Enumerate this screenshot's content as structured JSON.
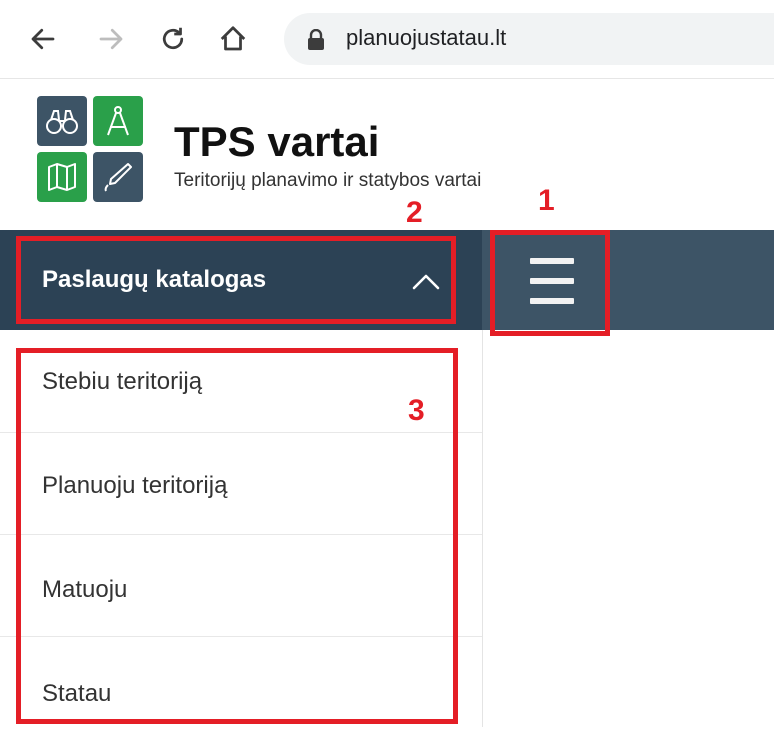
{
  "browser": {
    "url": "planuojustatau.lt",
    "icons": [
      "back-arrow-icon",
      "forward-arrow-icon",
      "reload-icon",
      "home-icon",
      "lock-icon"
    ]
  },
  "site": {
    "title": "TPS vartai",
    "subtitle": "Teritorijų planavimo ir statybos vartai",
    "logo_icons": [
      "binoculars-icon",
      "compass-icon",
      "map-icon",
      "pen-icon"
    ]
  },
  "nav": {
    "catalog_label": "Paslaugų katalogas",
    "items": [
      {
        "label": "Stebiu teritoriją"
      },
      {
        "label": "Planuoju teritoriją"
      },
      {
        "label": "Matuoju"
      },
      {
        "label": "Statau"
      }
    ]
  },
  "annotations": [
    {
      "label": "1"
    },
    {
      "label": "2"
    },
    {
      "label": "3"
    }
  ],
  "colors": {
    "navbar": "#3d5466",
    "catalog_bg": "#2c4255",
    "annotation": "#e41e26",
    "logo_dark": "#3d5466",
    "logo_green": "#2aa04a"
  }
}
